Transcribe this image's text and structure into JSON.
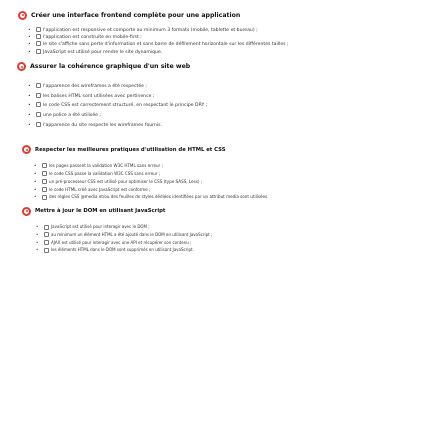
{
  "sections": [
    {
      "title": "Créer une interface frontend complète pour une application",
      "items": [
        "l'application est responsive et comporte au minimum 3 formats (mobile, tablette et bureau) ;",
        "l'application est construite en mobile-first ;",
        "le site s'affiche sans perte d'information et sans barre de défilement horizontale sur les différentes tailles ;",
        "JavaScript est utilisé pour rendre le site dynamique."
      ]
    },
    {
      "title": "Assurer la cohérence graphique d'un site web",
      "items": [
        "l'apparence des wireframes a été respectée ;",
        "les balises HTML sont utilisées avec pertinence ;",
        "le code CSS est correctement structuré, en respectant le principe DRY ;",
        "une police a été utilisée ;",
        "l'apparence du site respecte les wireframes fournis."
      ]
    },
    {
      "title": "Respecter les meilleures pratiques d'utilisation de HTML et CSS",
      "items": [
        "les pages passent la validation W3C HTML sans erreur ;",
        "le code CSS passe la validation W3C CSS sans erreur ;",
        "un pré-processeur CSS est utilisé pour optimiser le CSS (type SASS, Less) ;",
        "le code HTML créé avec JavaScript est conforme ;",
        "des règles CSS @media et/ou des feuilles de styles dédiées identifiées par un attribut media sont utilisées."
      ]
    },
    {
      "title": "Mettre à jour le DOM en utilisant JavaScript",
      "items": [
        "JavaScript est utilisé pour interagir avec le DOM ;",
        "au minimum un élément HTML a été ajouté dans le DOM en utilisant JavaScript ;",
        "AJAX est utilisé pour interagir avec une API et récupérer son contenu ;",
        "les éléments HTML dans le DOM sont supprimés en utilisant JavaScript."
      ]
    }
  ]
}
